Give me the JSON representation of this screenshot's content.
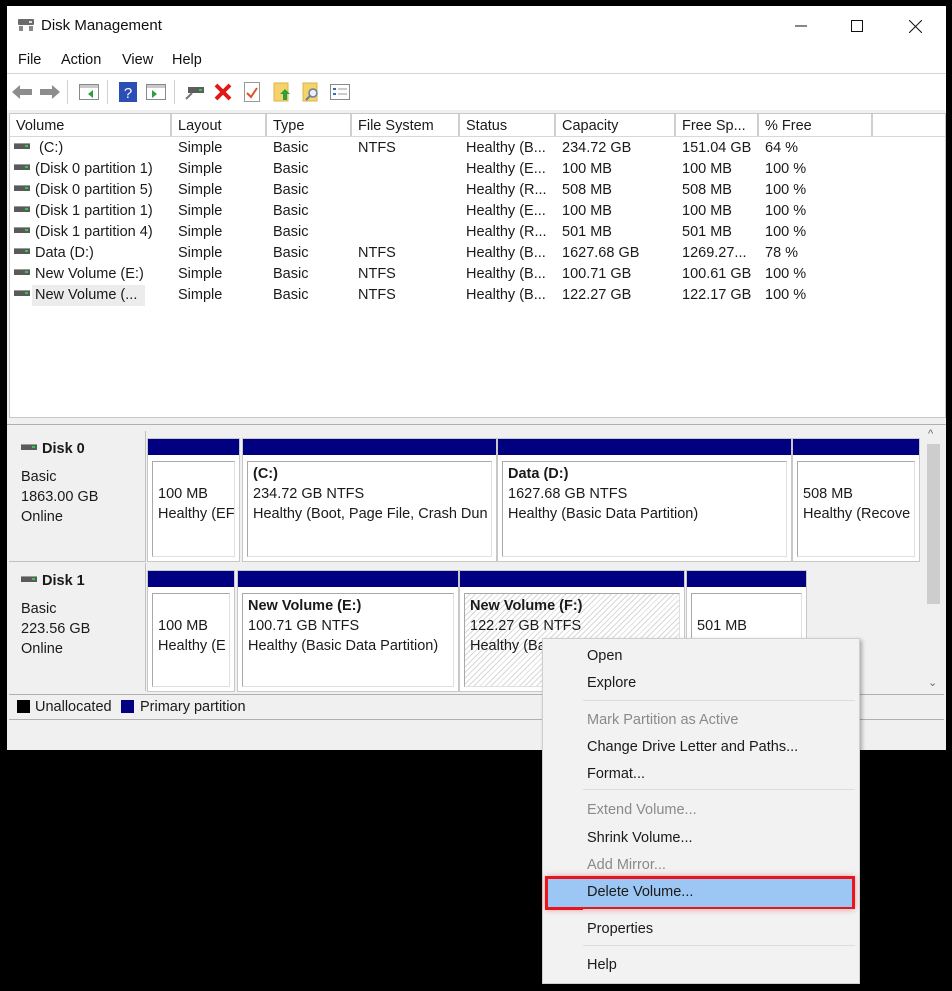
{
  "window": {
    "title": "Disk Management",
    "icons": {
      "app": "disk-management-icon",
      "minimize": "minimize-icon",
      "maximize": "maximize-icon",
      "close": "close-icon"
    }
  },
  "menubar": [
    "File",
    "Action",
    "View",
    "Help"
  ],
  "toolbar": [
    {
      "name": "back-icon"
    },
    {
      "name": "forward-icon"
    },
    {
      "name": "show-hide-console-tree-icon"
    },
    {
      "name": "help-icon"
    },
    {
      "name": "show-action-pane-icon"
    },
    {
      "name": "connect-disk-icon"
    },
    {
      "name": "delete-icon"
    },
    {
      "name": "properties-checklist-icon"
    },
    {
      "name": "open-folder-icon"
    },
    {
      "name": "explore-folder-icon"
    },
    {
      "name": "list-view-icon"
    }
  ],
  "volume_list": {
    "columns": [
      "Volume",
      "Layout",
      "Type",
      "File System",
      "Status",
      "Capacity",
      "Free Sp...",
      "% Free"
    ],
    "rows": [
      {
        "volume": " (C:)",
        "layout": "Simple",
        "type": "Basic",
        "fs": "NTFS",
        "status": "Healthy (B...",
        "capacity": "234.72 GB",
        "free": "151.04 GB",
        "pct": "64 %"
      },
      {
        "volume": "(Disk 0 partition 1)",
        "layout": "Simple",
        "type": "Basic",
        "fs": "",
        "status": "Healthy (E...",
        "capacity": "100 MB",
        "free": "100 MB",
        "pct": "100 %"
      },
      {
        "volume": "(Disk 0 partition 5)",
        "layout": "Simple",
        "type": "Basic",
        "fs": "",
        "status": "Healthy (R...",
        "capacity": "508 MB",
        "free": "508 MB",
        "pct": "100 %"
      },
      {
        "volume": "(Disk 1 partition 1)",
        "layout": "Simple",
        "type": "Basic",
        "fs": "",
        "status": "Healthy (E...",
        "capacity": "100 MB",
        "free": "100 MB",
        "pct": "100 %"
      },
      {
        "volume": "(Disk 1 partition 4)",
        "layout": "Simple",
        "type": "Basic",
        "fs": "",
        "status": "Healthy (R...",
        "capacity": "501 MB",
        "free": "501 MB",
        "pct": "100 %"
      },
      {
        "volume": "Data (D:)",
        "layout": "Simple",
        "type": "Basic",
        "fs": "NTFS",
        "status": "Healthy (B...",
        "capacity": "1627.68 GB",
        "free": "1269.27...",
        "pct": "78 %"
      },
      {
        "volume": "New Volume (E:)",
        "layout": "Simple",
        "type": "Basic",
        "fs": "NTFS",
        "status": "Healthy (B...",
        "capacity": "100.71 GB",
        "free": "100.61 GB",
        "pct": "100 %"
      },
      {
        "volume": "New Volume (...",
        "layout": "Simple",
        "type": "Basic",
        "fs": "NTFS",
        "status": "Healthy (B...",
        "capacity": "122.27 GB",
        "free": "122.17 GB",
        "pct": "100 %"
      }
    ]
  },
  "disks": [
    {
      "name": "Disk 0",
      "type": "Basic",
      "size": "1863.00 GB",
      "status": "Online",
      "partitions": [
        {
          "title": "",
          "line1": "100 MB",
          "line2": "Healthy (EF"
        },
        {
          "title": "(C:)",
          "line1": "234.72 GB NTFS",
          "line2": "Healthy (Boot, Page File, Crash Dun"
        },
        {
          "title": "Data  (D:)",
          "line1": "1627.68 GB NTFS",
          "line2": "Healthy (Basic Data Partition)"
        },
        {
          "title": "",
          "line1": "508 MB",
          "line2": "Healthy (Recove"
        }
      ]
    },
    {
      "name": "Disk 1",
      "type": "Basic",
      "size": "223.56 GB",
      "status": "Online",
      "partitions": [
        {
          "title": "",
          "line1": "100 MB",
          "line2": "Healthy (E"
        },
        {
          "title": "New Volume  (E:)",
          "line1": "100.71 GB NTFS",
          "line2": "Healthy (Basic Data Partition)"
        },
        {
          "title": "New Volume  (F:)",
          "line1": "122.27 GB NTFS",
          "line2": "Healthy (Ba",
          "selected": true
        },
        {
          "title": "",
          "line1": "501 MB",
          "line2": ""
        }
      ]
    }
  ],
  "legend": [
    {
      "label": "Unallocated",
      "color": "#000000"
    },
    {
      "label": "Primary partition",
      "color": "#000080"
    }
  ],
  "context_menu": {
    "items": [
      {
        "label": "Open",
        "enabled": true
      },
      {
        "label": "Explore",
        "enabled": true
      },
      {
        "label": "Mark Partition as Active",
        "enabled": false
      },
      {
        "label": "Change Drive Letter and Paths...",
        "enabled": true
      },
      {
        "label": "Format...",
        "enabled": true
      },
      {
        "label": "Extend Volume...",
        "enabled": false
      },
      {
        "label": "Shrink Volume...",
        "enabled": true
      },
      {
        "label": "Add Mirror...",
        "enabled": false
      },
      {
        "label": "Delete Volume...",
        "enabled": true,
        "highlighted": true
      },
      {
        "label": "Properties",
        "enabled": true
      },
      {
        "label": "Help",
        "enabled": true
      }
    ],
    "highlight_color": "#9cc6f3",
    "annotation_color": "#e8151c"
  }
}
